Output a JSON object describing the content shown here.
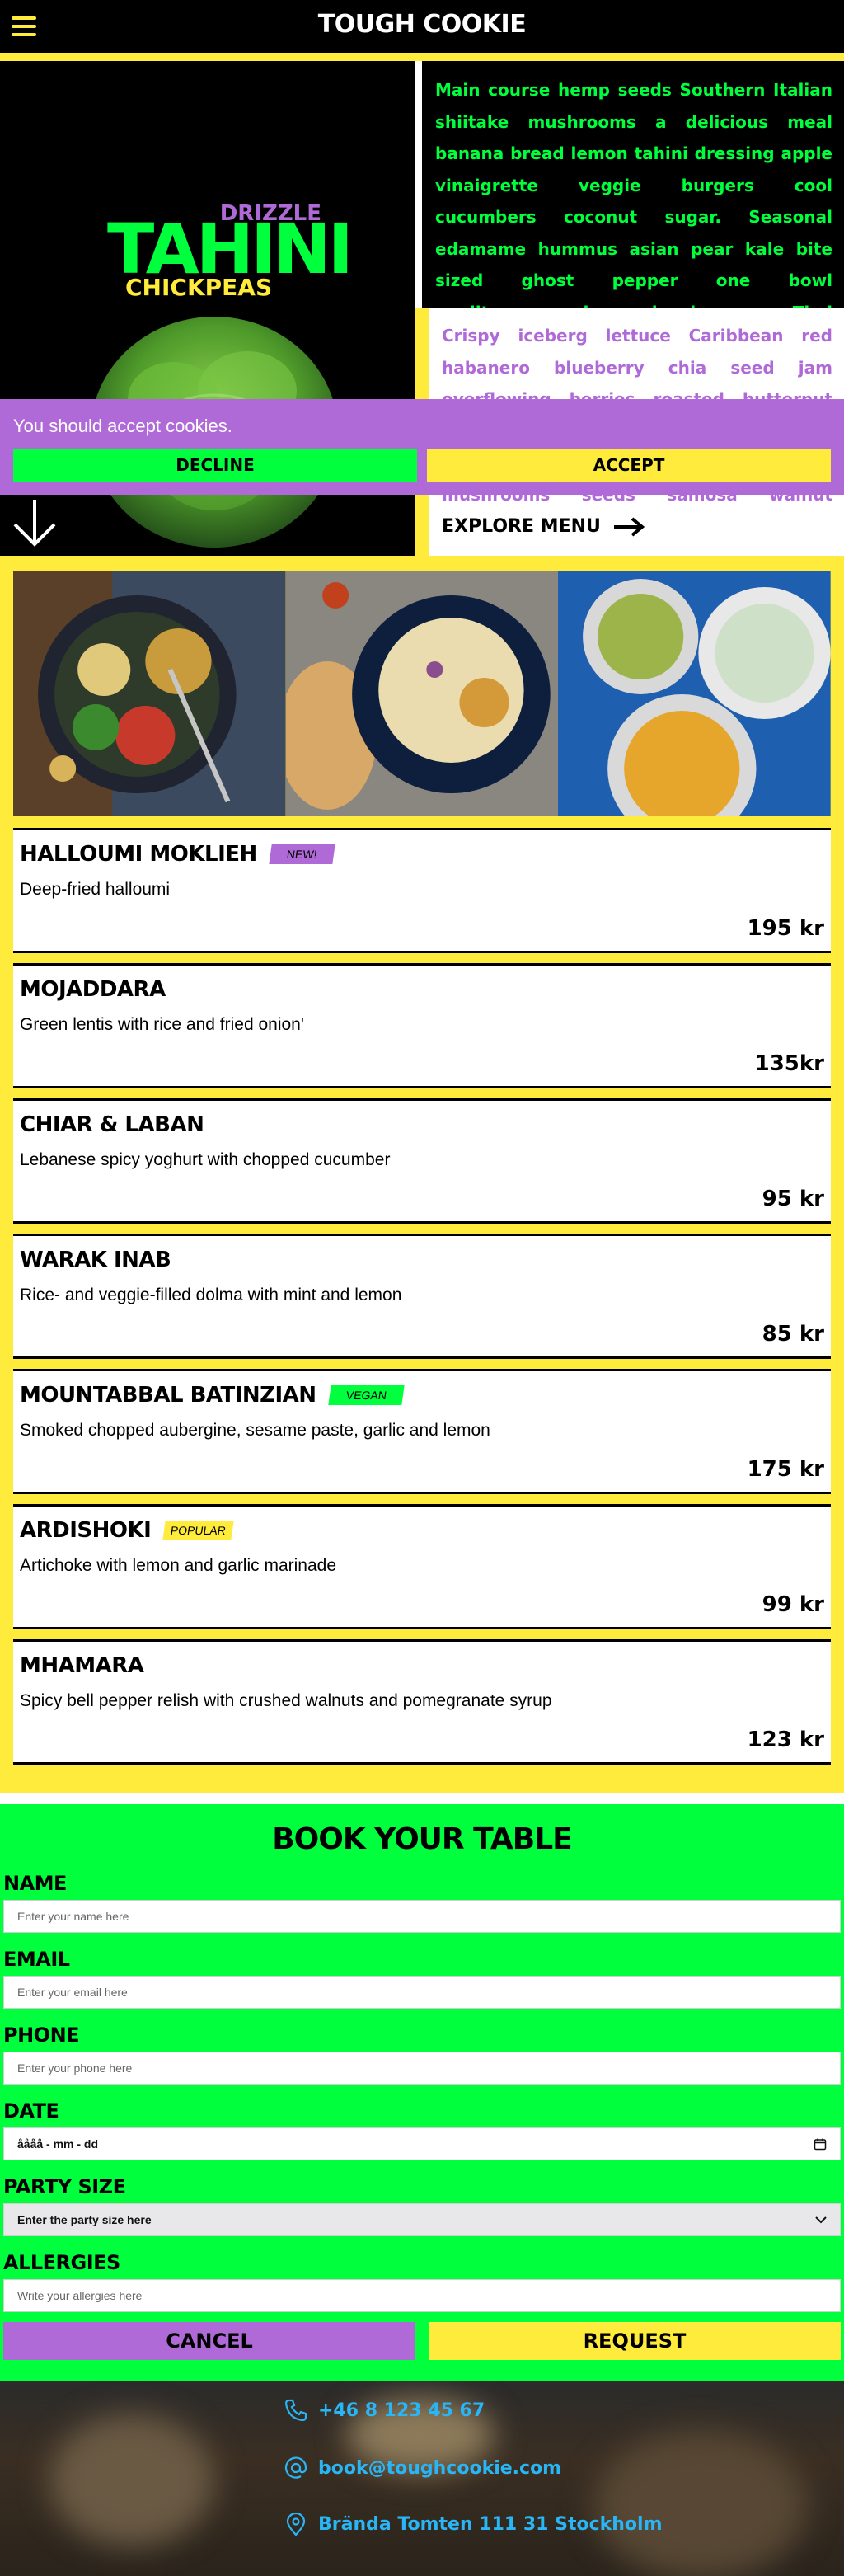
{
  "header": {
    "brand": "TOUGH COOKIE",
    "menu_icon": "hamburger-icon"
  },
  "hero": {
    "logo": {
      "drizzle": "DRIZZLE",
      "tahini": "TAHINI",
      "chickpeas": "CHICKPEAS"
    },
    "green_text": "Main course hemp seeds Southern Italian shiitake mushrooms a delicious meal banana bread lemon tahini dressing apple vinaigrette veggie burgers cool cucumbers coconut sugar. Seasonal edamame hummus asian pear kale bite sized ghost pepper one bowl mediterranean luxury bowl cayenne Thai sun pepper.",
    "purple_text": "Crispy iceberg lettuce Caribbean red habanero blueberry chia seed jam overflowing berries roasted butternut squash basmati thyme hummus mediterranean vegetables shiitake mushrooms seeds samosa walnut mushroom tart.",
    "explore_label": "EXPLORE MENU"
  },
  "cookie_banner": {
    "text": "You should accept cookies.",
    "decline": "DECLINE",
    "accept": "ACCEPT"
  },
  "menu": [
    {
      "name": "HALLOUMI MOKLIEH",
      "badge": "NEW!",
      "badge_color": "#b06ad8",
      "desc": "Deep-fried halloumi",
      "price": "195 kr"
    },
    {
      "name": "MOJADDARA",
      "badge": "",
      "badge_color": "",
      "desc": "Green lentis with rice and fried onion'",
      "price": "135kr"
    },
    {
      "name": "CHIAR & LABAN",
      "badge": "",
      "badge_color": "",
      "desc": "Lebanese spicy yoghurt with chopped cucumber",
      "price": "95 kr"
    },
    {
      "name": "WARAK INAB",
      "badge": "",
      "badge_color": "",
      "desc": "Rice- and veggie-filled dolma with mint and lemon",
      "price": "85 kr"
    },
    {
      "name": "MOUNTABBAL BATINZIAN",
      "badge": "VEGAN",
      "badge_color": "#00ff3c",
      "desc": "Smoked chopped aubergine, sesame paste, garlic and lemon",
      "price": "175 kr"
    },
    {
      "name": "ARDISHOKI",
      "badge": "POPULAR",
      "badge_color": "#ffeb3b",
      "desc": "Artichoke with lemon and garlic marinade",
      "price": "99 kr"
    },
    {
      "name": "MHAMARA",
      "badge": "",
      "badge_color": "",
      "desc": "Spicy bell pepper relish with crushed walnuts and pomegranate syrup",
      "price": "123 kr"
    }
  ],
  "booking": {
    "title": "BOOK YOUR TABLE",
    "fields": {
      "name": {
        "label": "NAME",
        "placeholder": "Enter your name here"
      },
      "email": {
        "label": "EMAIL",
        "placeholder": "Enter your email here"
      },
      "phone": {
        "label": "PHONE",
        "placeholder": "Enter your phone here"
      },
      "date": {
        "label": "DATE",
        "placeholder": "åååå - mm - dd"
      },
      "party": {
        "label": "PARTY SIZE",
        "placeholder": "Enter the party size here"
      },
      "allergies": {
        "label": "ALLERGIES",
        "placeholder": "Write your allergies here"
      }
    },
    "cancel": "CANCEL",
    "request": "REQUEST"
  },
  "footer": {
    "phone": "+46 8 123 45 67",
    "email": "book@toughcookie.com",
    "address": "Brända Tomten 111 31 Stockholm"
  },
  "colors": {
    "yellow": "#ffeb3b",
    "green": "#00ff3c",
    "purple": "#b06ad8",
    "link": "#29b6f6"
  }
}
